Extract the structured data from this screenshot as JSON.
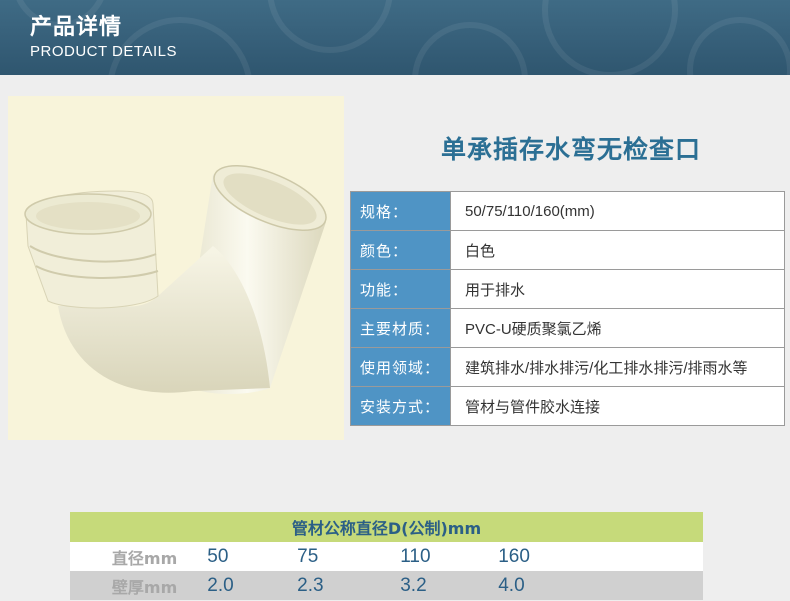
{
  "header": {
    "title_cn": "产品详情",
    "title_en": "PRODUCT DETAILS"
  },
  "product": {
    "title": "单承插存水弯无检查口",
    "specs": [
      {
        "label": "规格：",
        "value": "50/75/110/160(mm)"
      },
      {
        "label": "颜色：",
        "value": "白色"
      },
      {
        "label": "功能：",
        "value": "用于排水"
      },
      {
        "label": "主要材质：",
        "value": "PVC-U硬质聚氯乙烯"
      },
      {
        "label": "使用领域：",
        "value": "建筑排水/排水排污/化工排水排污/排雨水等"
      },
      {
        "label": "安装方式：",
        "value": "管材与管件胶水连接"
      }
    ]
  },
  "dimensions": {
    "header": "管材公称直径D(公制)mm",
    "rows": [
      {
        "label": "直径mm",
        "values": [
          "50",
          "75",
          "110",
          "160"
        ]
      },
      {
        "label": "壁厚mm",
        "values": [
          "2.0",
          "2.3",
          "3.2",
          "4.0"
        ]
      }
    ]
  },
  "colors": {
    "banner": "#3a6680",
    "spec_label_bg": "#4f94c5",
    "title_blue": "#2b6f94",
    "dim_header_bg": "#c6da7a",
    "photo_bg": "#f8f4da"
  }
}
